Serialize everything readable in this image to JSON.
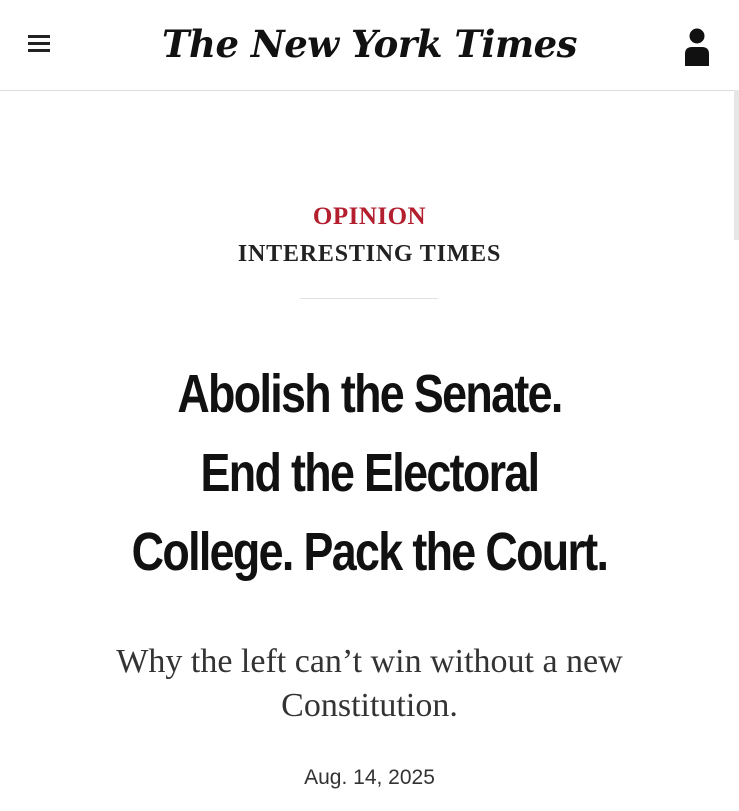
{
  "header": {
    "logo_text": "The New York Times",
    "menu_icon": "hamburger-menu-icon",
    "account_icon": "user-account-icon"
  },
  "article": {
    "kicker": "OPINION",
    "column": "INTERESTING TIMES",
    "headline_lines": [
      "Abolish the Senate.",
      "End the Electoral",
      "College. Pack the Court."
    ],
    "dek_lines": [
      "Why the left can’t win without a new",
      "Constitution."
    ],
    "date": "Aug. 14, 2025"
  },
  "colors": {
    "kicker": "#b31f2e",
    "text": "#121212",
    "divider": "#e2e2e2"
  }
}
